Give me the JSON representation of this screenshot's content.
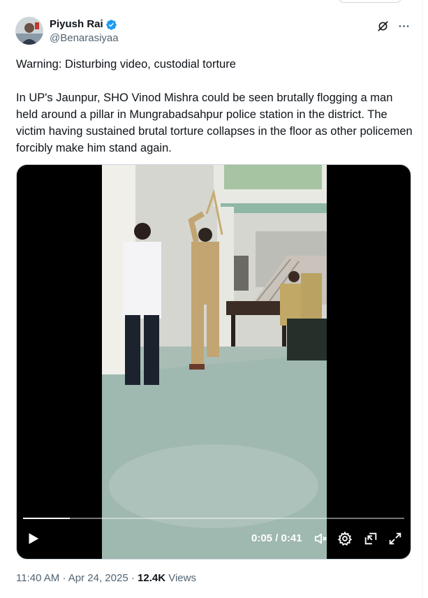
{
  "author": {
    "display_name": "Piyush Rai",
    "handle": "@Benarasiyaa"
  },
  "tweet": {
    "line1": "Warning: Disturbing video, custodial torture",
    "line2": "In UP's Jaunpur, SHO Vinod Mishra could be seen brutally flogging a man held around a pillar in Mungrabadsahpur police station in the district. The victim having sustained brutal torture collapses in the floor as other policemen forcibly make him stand again."
  },
  "video": {
    "time_display": "0:05 / 0:41",
    "progress": 0.122
  },
  "meta": {
    "time": "11:40 AM",
    "separator": "·",
    "date": "Apr 24, 2025",
    "views_count": "12.4K",
    "views_label": "Views"
  },
  "icons": {
    "verified": "verified-badge-icon",
    "grok": "grok-icon",
    "more": "more-icon",
    "play": "play-icon",
    "mute": "mute-icon",
    "settings": "gear-icon",
    "pip": "picture-in-picture-icon",
    "fullscreen": "fullscreen-icon"
  },
  "colors": {
    "verified": "#1d9bf0",
    "text": "#0f1419",
    "secondary": "#536471"
  }
}
